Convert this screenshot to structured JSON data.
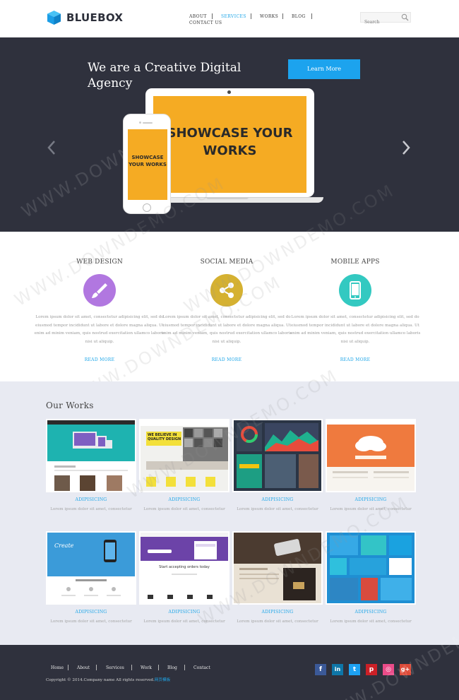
{
  "header": {
    "logo_text": "BLUEBOX",
    "nav": [
      {
        "label": "ABOUT"
      },
      {
        "label": "SERVICES"
      },
      {
        "label": "WORKS"
      },
      {
        "label": "BLOG"
      },
      {
        "label": "CONTACT US"
      }
    ],
    "search_placeholder": "Search"
  },
  "hero": {
    "title": "We are a Creative Digital Agency",
    "cta_label": "Learn More",
    "laptop_screen_text": "SHOWCASE YOUR WORKS",
    "phone_screen_text": "SHOWCASE YOUR WORKS"
  },
  "services": [
    {
      "title": "WEB DESIGN",
      "icon": "brush-icon",
      "color": "#b177e0",
      "description": "Lorem ipsum dolor sit amet, consectetur adipisicing elit, sed do eiusmod tempor incididunt ut labore et dolore magna aliqua. Ut enim ad minim veniam, quis nostrud exercitation ullamco laboris nisi ut aliquip.",
      "link": "READ MORE"
    },
    {
      "title": "SOCIAL MEDIA",
      "icon": "share-icon",
      "color": "#d5b131",
      "description": "Lorem ipsum dolor sit amet, consectetur adipisicing elit, sed do eiusmod tempor incididunt ut labore et dolore magna aliqua. Ut enim ad minim veniam, quis nostrud exercitation ullamco laboris nisi ut aliquip.",
      "link": "READ MORE"
    },
    {
      "title": "MOBILE APPS",
      "icon": "mobile-icon",
      "color": "#33c9c1",
      "description": "Lorem ipsum dolor sit amet, consectetur adipisicing elit, sed do eiusmod tempor incididunt ut labore et dolore magna aliqua. Ut enim ad minim veniam, quis nostrud exercitation ullamco laboris nisi ut aliquip.",
      "link": "READ MORE"
    }
  ],
  "works": {
    "title": "Our Works",
    "items": [
      {
        "title": "ADIPISICING",
        "description": "Lorem ipsum dolor sit amet, consectetur"
      },
      {
        "title": "ADIPISICING",
        "description": "Lorem ipsum dolor sit amet, consectetur",
        "thumb_text": "WE BELIEVE IN QUALITY DESIGN"
      },
      {
        "title": "ADIPISICING",
        "description": "Lorem ipsum dolor sit amet, consectetur"
      },
      {
        "title": "ADIPISICING",
        "description": "Lorem ipsum dolor sit amet, consectetur"
      },
      {
        "title": "ADIPISICING",
        "description": "Lorem ipsum dolor sit amet, consectetur",
        "thumb_text": "Create"
      },
      {
        "title": "ADIPISICING",
        "description": "Lorem ipsum dolor sit amet, consectetur",
        "thumb_text": "Start accepting orders today"
      },
      {
        "title": "ADIPISICING",
        "description": "Lorem ipsum dolor sit amet, consectetur"
      },
      {
        "title": "ADIPISICING",
        "description": "Lorem ipsum dolor sit amet, consectetur"
      }
    ]
  },
  "footer": {
    "nav": [
      {
        "label": "Home"
      },
      {
        "label": "About"
      },
      {
        "label": "Services"
      },
      {
        "label": "Work"
      },
      {
        "label": "Blog"
      },
      {
        "label": "Contact"
      }
    ],
    "copyright": "Copyright © 2014.Company name All rights reserved.",
    "copyright_link": "网页模板",
    "social": [
      {
        "icon": "facebook-icon",
        "glyph": "f",
        "color": "#3b5998"
      },
      {
        "icon": "linkedin-icon",
        "glyph": "in",
        "color": "#0e76a8"
      },
      {
        "icon": "twitter-icon",
        "glyph": "t",
        "color": "#1da1f2"
      },
      {
        "icon": "pinterest-icon",
        "glyph": "p",
        "color": "#cb2027"
      },
      {
        "icon": "dribbble-icon",
        "glyph": "◎",
        "color": "#ea4c89"
      },
      {
        "icon": "google-plus-icon",
        "glyph": "g+",
        "color": "#dd4b39"
      }
    ]
  },
  "watermark": "WWW.DOWNDEMO.COM",
  "colors": {
    "accent": "#1ea6e8",
    "dark": "#2f313d",
    "works_bg": "#e8eaf2",
    "showcase_yellow": "#f5ab23"
  }
}
